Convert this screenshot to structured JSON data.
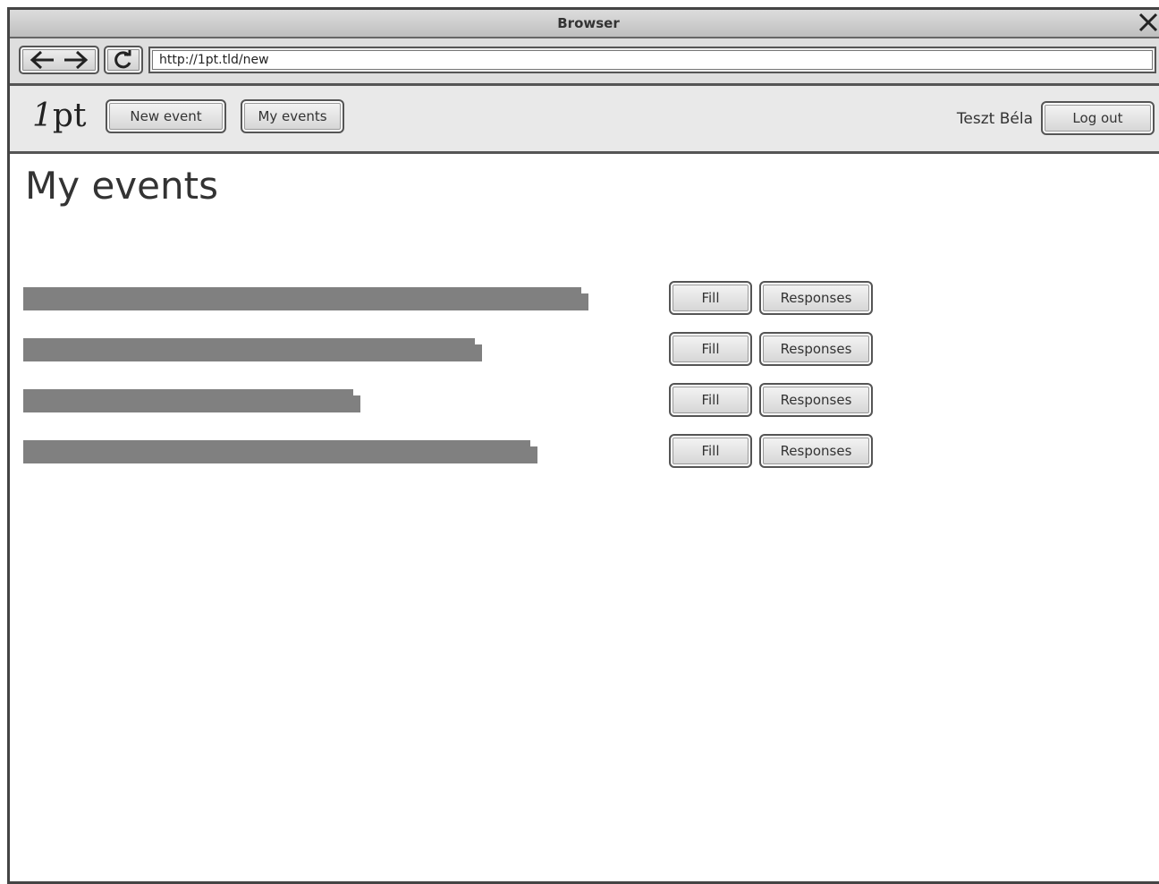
{
  "browser": {
    "title": "Browser",
    "url": "http://1pt.tld/new",
    "back_icon": "arrow-left-icon",
    "forward_icon": "arrow-right-icon",
    "reload_icon": "reload-icon",
    "close_icon": "close-icon"
  },
  "app": {
    "logo_one": "1",
    "logo_rest": "pt",
    "nav": {
      "new_event": "New event",
      "my_events": "My events"
    },
    "user": "Teszt Béla",
    "logout": "Log out"
  },
  "page": {
    "title": "My events"
  },
  "events": [
    {
      "fill": "Fill",
      "responses": "Responses"
    },
    {
      "fill": "Fill",
      "responses": "Responses"
    },
    {
      "fill": "Fill",
      "responses": "Responses"
    },
    {
      "fill": "Fill",
      "responses": "Responses"
    }
  ],
  "colors": {
    "redacted_bar": "#808080",
    "appbar_bg": "#e9e9e9",
    "border": "#555555"
  }
}
